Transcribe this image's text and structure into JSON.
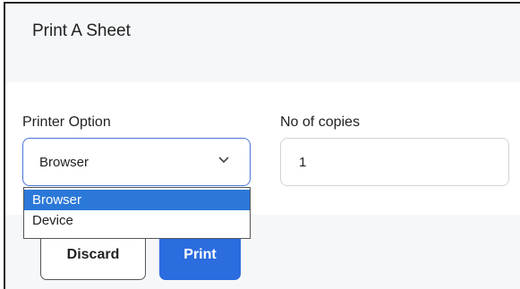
{
  "dialog": {
    "title": "Print A Sheet"
  },
  "form": {
    "printer_option_label": "Printer Option",
    "printer_option_value": "Browser",
    "printer_options": [
      "Browser",
      "Device"
    ],
    "copies_label": "No of copies",
    "copies_value": "1"
  },
  "buttons": {
    "discard": "Discard",
    "print": "Print"
  },
  "icons": {
    "select_toggle": "chevron-down-icon"
  },
  "colors": {
    "primary": "#2b6cde",
    "dropdown_highlight": "#2b78d9",
    "focus_border": "#4a74d8"
  }
}
